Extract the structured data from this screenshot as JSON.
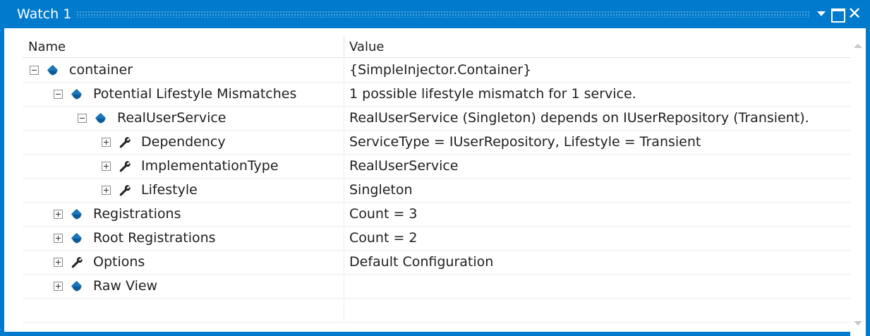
{
  "window": {
    "title": "Watch 1",
    "accent_color": "#007acc",
    "buttons": {
      "dropdown_icon": "dropdown-arrow-icon",
      "maximize_icon": "maximize-icon",
      "close_icon": "close-icon",
      "close_glyph": "✕"
    }
  },
  "columns": {
    "name": "Name",
    "value": "Value"
  },
  "rows": [
    {
      "name": "container",
      "value": "{SimpleInjector.Container}",
      "depth": 0,
      "expander": "collapse",
      "icon": "object-icon"
    },
    {
      "name": "Potential Lifestyle Mismatches",
      "value": "1 possible lifestyle mismatch for 1 service.",
      "depth": 1,
      "expander": "collapse",
      "icon": "object-icon"
    },
    {
      "name": "RealUserService",
      "value": "RealUserService (Singleton) depends on IUserRepository (Transient).",
      "depth": 2,
      "expander": "collapse",
      "icon": "object-icon"
    },
    {
      "name": "Dependency",
      "value": "ServiceType = IUserRepository, Lifestyle = Transient",
      "depth": 3,
      "expander": "expand",
      "icon": "wrench-icon"
    },
    {
      "name": "ImplementationType",
      "value": "RealUserService",
      "depth": 3,
      "expander": "expand",
      "icon": "wrench-icon"
    },
    {
      "name": "Lifestyle",
      "value": "Singleton",
      "depth": 3,
      "expander": "expand",
      "icon": "wrench-icon"
    },
    {
      "name": "Registrations",
      "value": "Count = 3",
      "depth": 1,
      "expander": "expand",
      "icon": "object-icon"
    },
    {
      "name": "Root Registrations",
      "value": "Count = 2",
      "depth": 1,
      "expander": "expand",
      "icon": "object-icon"
    },
    {
      "name": "Options",
      "value": "Default Configuration",
      "depth": 1,
      "expander": "expand",
      "icon": "wrench-icon"
    },
    {
      "name": "Raw View",
      "value": "",
      "depth": 1,
      "expander": "expand",
      "icon": "object-icon"
    }
  ]
}
